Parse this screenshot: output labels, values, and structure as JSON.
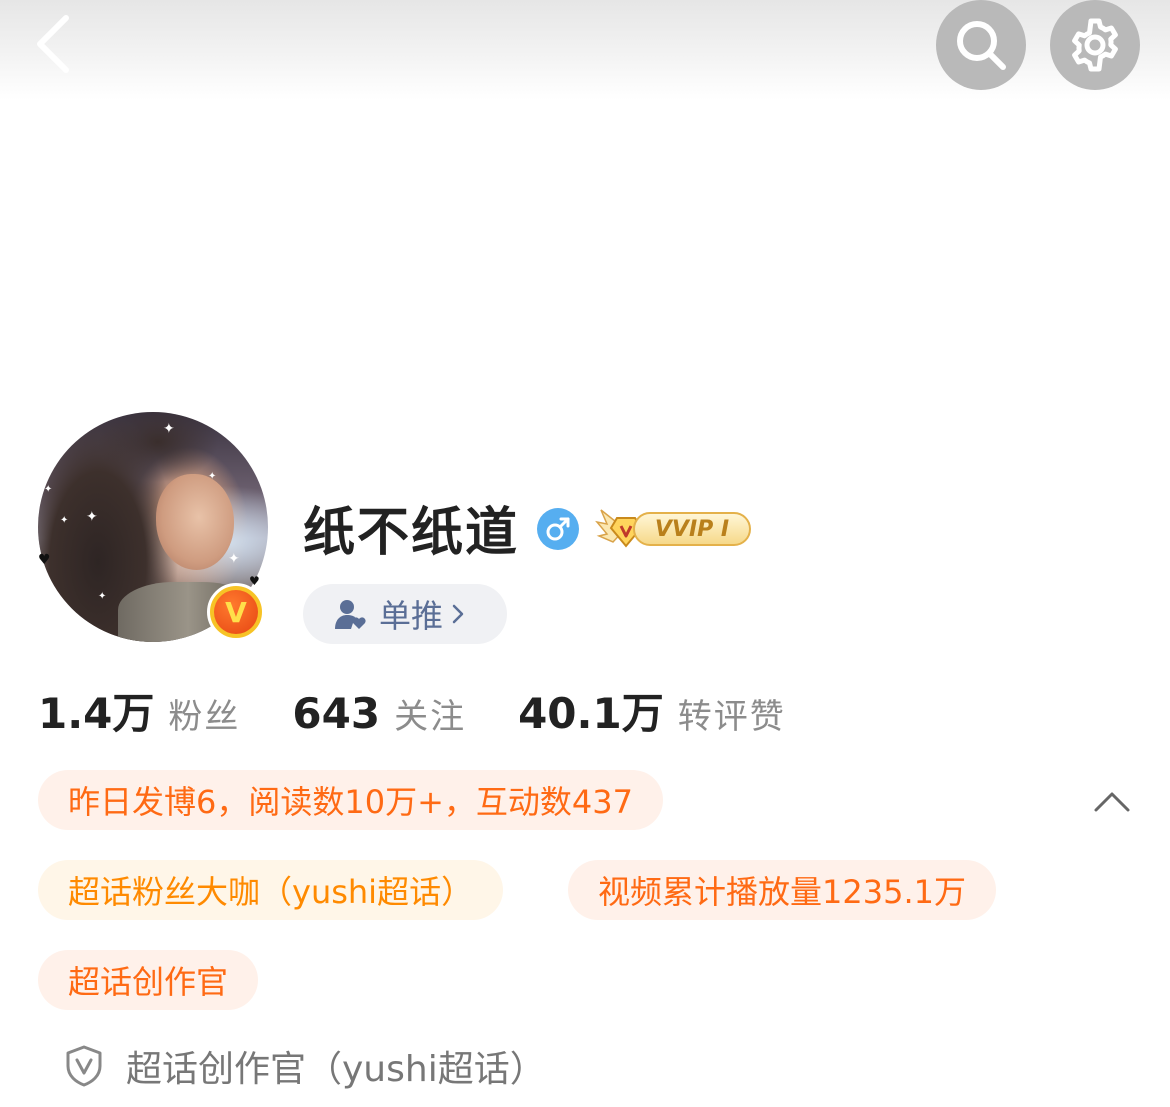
{
  "header": {
    "back_icon": "chevron-left-icon",
    "search_icon": "search-icon",
    "settings_icon": "gear-icon"
  },
  "profile": {
    "name": "纸不纸道",
    "gender": "male",
    "gender_symbol": "♂",
    "vip_label": "VVIP Ⅰ",
    "verified_badge": "V",
    "follow_button_label": "单推",
    "follow_button_chevron": "›",
    "accent_colors": {
      "orange_text": "#ff6a14",
      "gender_blue": "#56aef0",
      "vbadge_yellow": "#f7c326"
    }
  },
  "stats": [
    {
      "value": "1.4万",
      "label": "粉丝"
    },
    {
      "value": "643",
      "label": "关注"
    },
    {
      "value": "40.1万",
      "label": "转评赞"
    }
  ],
  "tags": {
    "daily_summary": "昨日发博6，阅读数10万+，互动数437",
    "super_fan": "超话粉丝大咖（yushi超话）",
    "video_views": "视频累计播放量1235.1万",
    "creator": "超话创作官"
  },
  "footer": {
    "icon": "shield-v-icon",
    "text": "超话创作官（yushi超话）"
  }
}
